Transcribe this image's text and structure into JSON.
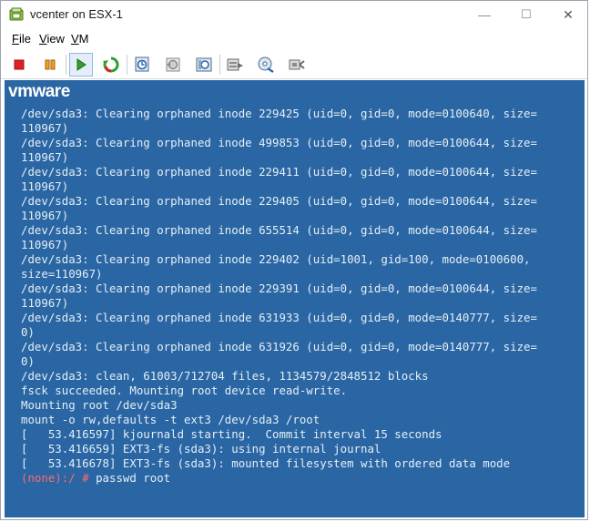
{
  "window": {
    "title": "vcenter on ESX-1",
    "controls": {
      "minimize": "—",
      "maximize": "☐",
      "close": "✕"
    }
  },
  "menu": [
    {
      "label": "File",
      "underline": "F",
      "rest": "ile"
    },
    {
      "label": "View",
      "underline": "V",
      "rest": "iew"
    },
    {
      "label": "VM",
      "underline": "V",
      "rest": "M"
    }
  ],
  "toolbar": {
    "buttons": [
      "stop-icon",
      "pause-icon",
      "play-icon",
      "reset-icon",
      "snapshot-icon",
      "revert-snapshot-icon",
      "snapshot-manager-icon",
      "send-ctrl-alt-del-icon",
      "cd-dvd-icon",
      "network-icon"
    ],
    "active": "play-icon"
  },
  "console": {
    "logo": "vmware",
    "lines": [
      "/dev/sda3: Clearing orphaned inode 229425 (uid=0, gid=0, mode=0100640, size=",
      "110967)",
      "/dev/sda3: Clearing orphaned inode 499853 (uid=0, gid=0, mode=0100644, size=",
      "110967)",
      "/dev/sda3: Clearing orphaned inode 229411 (uid=0, gid=0, mode=0100644, size=",
      "110967)",
      "/dev/sda3: Clearing orphaned inode 229405 (uid=0, gid=0, mode=0100644, size=",
      "110967)",
      "/dev/sda3: Clearing orphaned inode 655514 (uid=0, gid=0, mode=0100644, size=",
      "110967)",
      "/dev/sda3: Clearing orphaned inode 229402 (uid=1001, gid=100, mode=0100600,",
      "size=110967)",
      "/dev/sda3: Clearing orphaned inode 229391 (uid=0, gid=0, mode=0100644, size=",
      "110967)",
      "/dev/sda3: Clearing orphaned inode 631933 (uid=0, gid=0, mode=0140777, size=",
      "0)",
      "/dev/sda3: Clearing orphaned inode 631926 (uid=0, gid=0, mode=0140777, size=",
      "0)",
      "/dev/sda3: clean, 61003/712704 files, 1134579/2848512 blocks",
      "fsck succeeded. Mounting root device read-write.",
      "Mounting root /dev/sda3",
      "mount -o rw,defaults -t ext3 /dev/sda3 /root",
      "[   53.416597] kjournald starting.  Commit interval 15 seconds",
      "[   53.416659] EXT3-fs (sda3): using internal journal",
      "[   53.416678] EXT3-fs (sda3): mounted filesystem with ordered data mode"
    ],
    "prompt": "(none):/ #",
    "command": " passwd root"
  },
  "colors": {
    "console_bg": "#2966a3",
    "console_text": "#e6eef6",
    "prompt": "#ff6b6b"
  }
}
